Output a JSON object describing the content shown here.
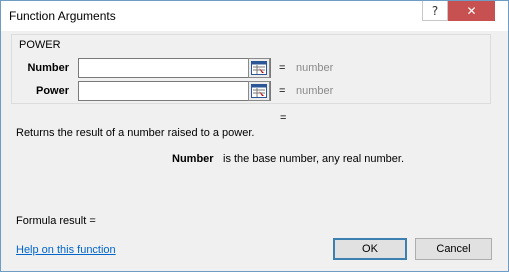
{
  "window": {
    "title": "Function Arguments",
    "help_glyph": "?",
    "close_glyph": "✕"
  },
  "function_name": "POWER",
  "args": [
    {
      "label": "Number",
      "value": "",
      "equals": "=",
      "hint": "number"
    },
    {
      "label": "Power",
      "value": "",
      "equals": "=",
      "hint": "number"
    }
  ],
  "result_equals": "=",
  "description": "Returns the result of a number raised to a power.",
  "param": {
    "name": "Number",
    "description": "is the base number, any real number."
  },
  "formula_result": "Formula result =",
  "help_link": "Help on this function",
  "buttons": {
    "ok": "OK",
    "cancel": "Cancel"
  }
}
